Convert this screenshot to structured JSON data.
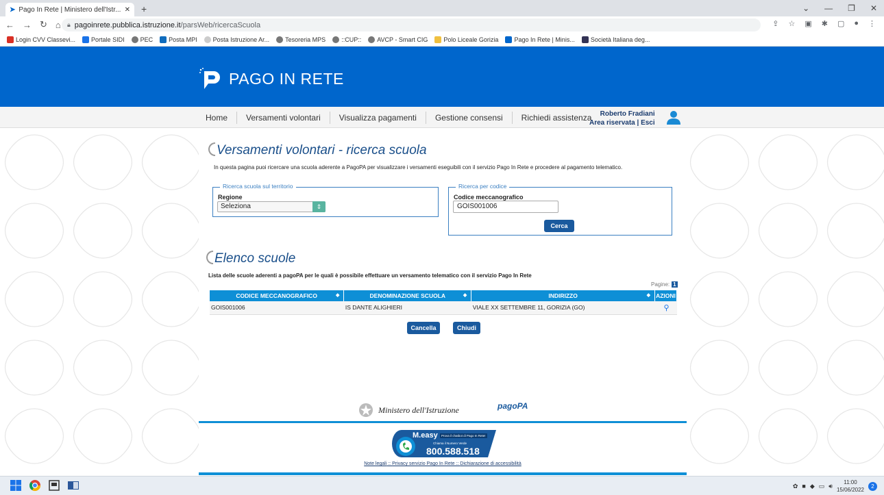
{
  "browser": {
    "tab_title": "Pago In Rete | Ministero dell'Istr...",
    "url_host": "pagoinrete.pubblica.istruzione.it",
    "url_path": "/parsWeb/ricercaScuola",
    "bookmarks": [
      "Login CVV Classevi...",
      "Portale SIDI",
      "PEC",
      "Posta MPI",
      "Posta Istruzione Ar...",
      "Tesoreria MPS",
      "::CUP::",
      "AVCP - Smart CIG",
      "Polo Liceale Gorizia",
      "Pago In Rete | Minis...",
      "Società Italiana deg..."
    ]
  },
  "site": {
    "logo_text": "PAGO IN RETE",
    "brand_color": "#0066cc",
    "nav": [
      "Home",
      "Versamenti volontari",
      "Visualizza pagamenti",
      "Gestione consensi",
      "Richiedi assistenza"
    ],
    "user_name": "Roberto Fradiani",
    "user_links": "Area riservata | Esci"
  },
  "search": {
    "title": "Versamenti volontari - ricerca scuola",
    "intro": "In questa pagina puoi ricercare una scuola aderente a PagoPA per visualizzare i versamenti eseguibili con il servizio Pago In Rete e procedere al pagamento telematico.",
    "territory_legend": "Ricerca scuola sul territorio",
    "region_label": "Regione",
    "region_value": "Seleziona",
    "code_legend": "Ricerca per codice",
    "code_label": "Codice meccanografico",
    "code_value": "GOIS001006",
    "search_button": "Cerca"
  },
  "list": {
    "title": "Elenco scuole",
    "intro": "Lista delle scuole aderenti a pagoPA per le quali è possibile effettuare un versamento telematico con il servizio Pago In Rete",
    "pages_label": "Pagine:",
    "page_number": "1",
    "columns": [
      "CODICE MECCANOGRAFICO",
      "DENOMINAZIONE SCUOLA",
      "INDIRIZZO",
      "AZIONI"
    ],
    "rows": [
      {
        "code": "GOIS001006",
        "name": "IS DANTE ALIGHIERI",
        "address": "VIALE XX SETTEMBRE 11, GORIZIA (GO)"
      }
    ],
    "cancel_button": "Cancella",
    "close_button": "Chiudi"
  },
  "footer": {
    "ministry": "Ministero dell'Istruzione",
    "pagopa": "pagoPA",
    "measy": "M.easy",
    "measy_tag": "Prova il chatbot di Pago In Rete!",
    "measy_call": "Chiama il Numero Verde",
    "phone": "800.588.518",
    "link1": "Note legali",
    "link2": "Privacy servizio Pago In Rete",
    "link3": "Dichiarazione di accessibilità"
  },
  "taskbar": {
    "time": "11:00",
    "date": "15/06/2022",
    "notif": "2"
  }
}
